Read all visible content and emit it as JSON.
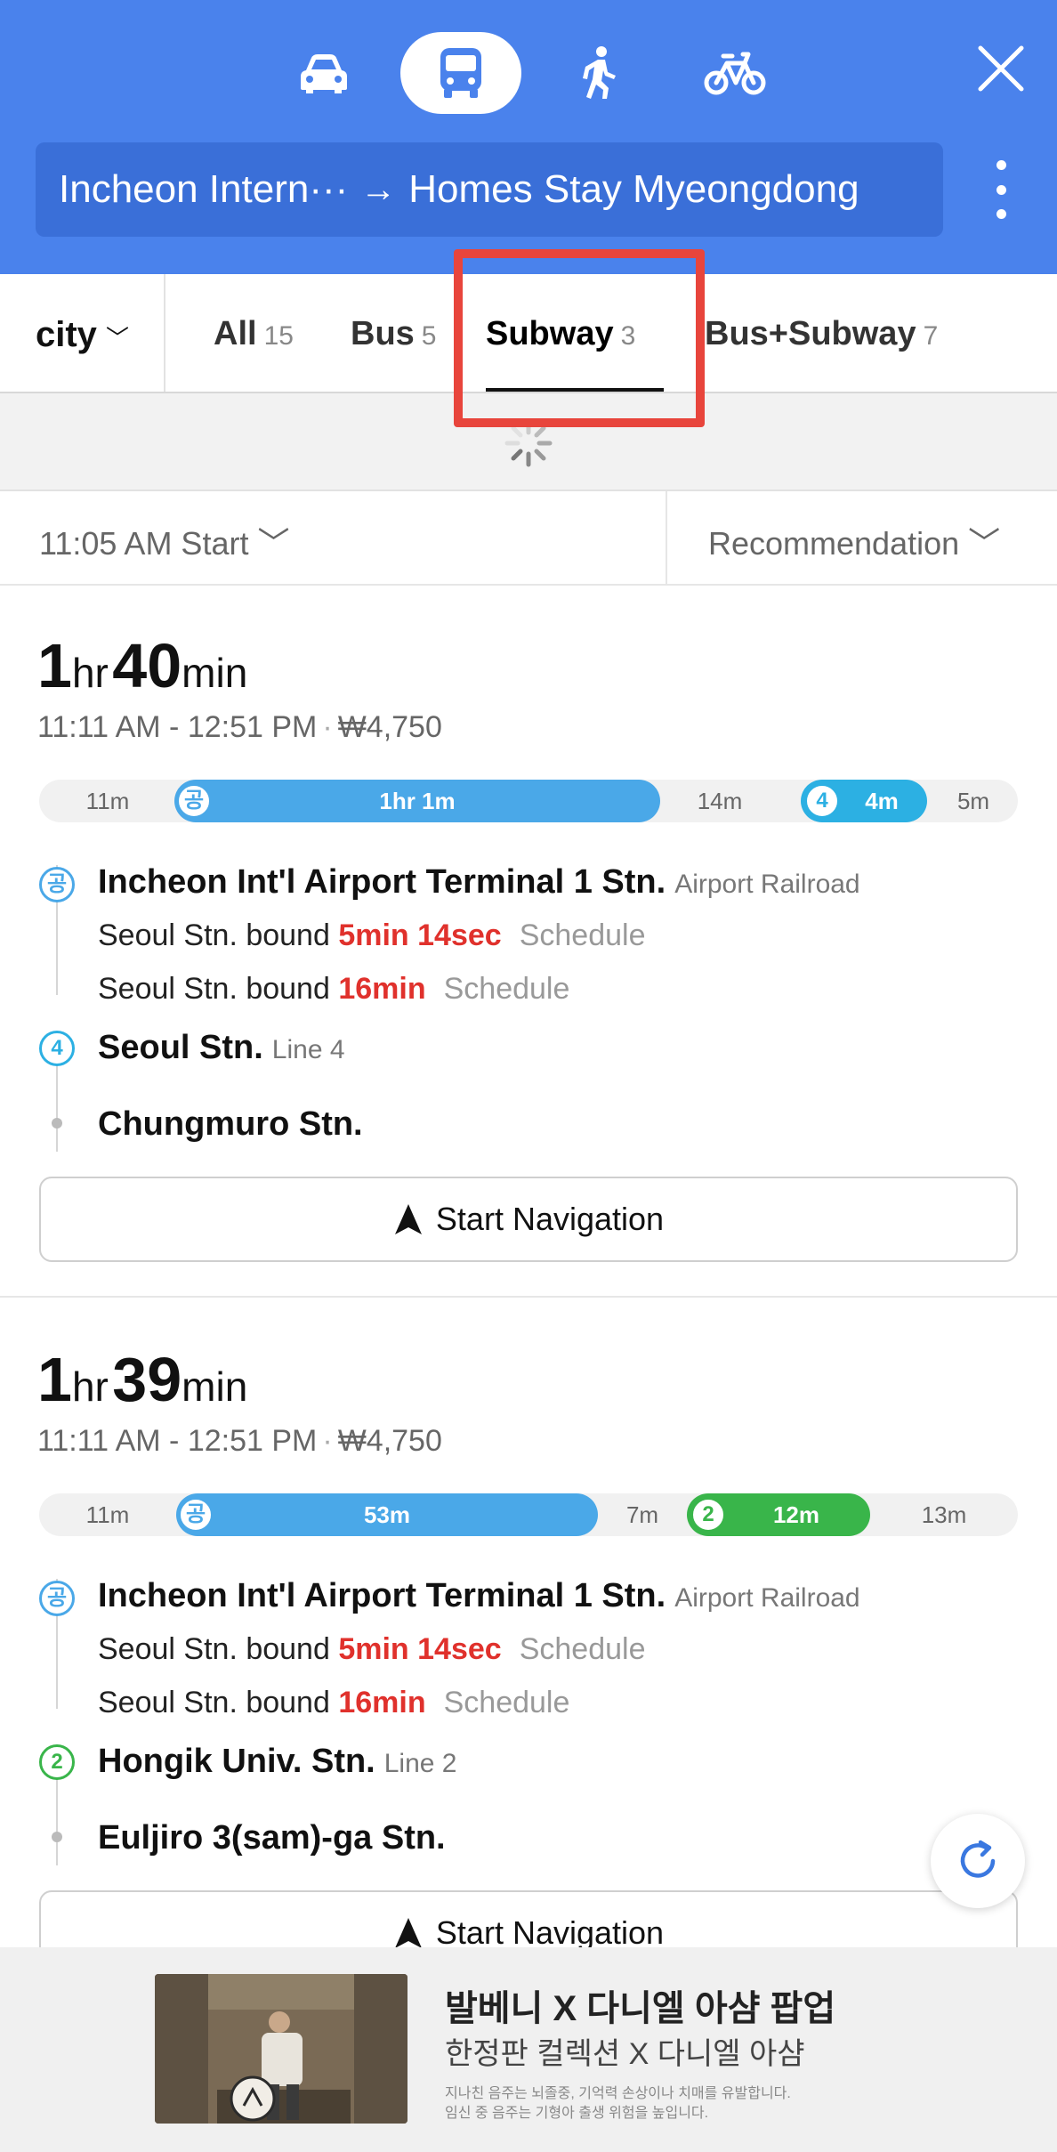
{
  "header": {
    "modes": [
      {
        "name": "car",
        "icon": "car-icon"
      },
      {
        "name": "transit",
        "icon": "bus-icon",
        "selected": true
      },
      {
        "name": "walk",
        "icon": "walk-icon"
      },
      {
        "name": "bike",
        "icon": "bike-icon"
      }
    ],
    "origin": "Incheon Intern···",
    "arrow": "→",
    "destination": "Homes Stay Myeongdong",
    "accent_color": "#4a82ec"
  },
  "tabs": {
    "region": "city",
    "items": [
      {
        "label": "All",
        "count": "15"
      },
      {
        "label": "Bus",
        "count": "5"
      },
      {
        "label": "Subway",
        "count": "3",
        "selected": true
      },
      {
        "label": "Bus+Subway",
        "count": "7"
      }
    ]
  },
  "options": {
    "start_time": "11:05 AM Start",
    "sort": "Recommendation"
  },
  "routes": [
    {
      "hours": "1",
      "hr_unit": "hr",
      "minutes": "40",
      "min_unit": "min",
      "time_range": "11:11 AM - 12:51 PM",
      "fare": "₩4,750",
      "timeline": [
        "11m",
        "1hr 1m",
        "14m",
        "4m",
        "5m"
      ],
      "stops": [
        {
          "badge": "공",
          "name": "Incheon Int'l Airport Terminal 1 Stn.",
          "line": "Airport Railroad"
        },
        {
          "badge": "4",
          "name": "Seoul Stn.",
          "line": "Line 4"
        },
        {
          "badge": "",
          "name": "Chungmuro Stn.",
          "line": ""
        }
      ],
      "arrivals": [
        {
          "bound": "Seoul Stn. bound",
          "time": "5min 14sec",
          "schedule": "Schedule"
        },
        {
          "bound": "Seoul Stn. bound",
          "time": "16min",
          "schedule": "Schedule"
        }
      ],
      "nav_label": "Start Navigation"
    },
    {
      "hours": "1",
      "hr_unit": "hr",
      "minutes": "39",
      "min_unit": "min",
      "time_range": "11:11 AM - 12:51 PM",
      "fare": "₩4,750",
      "timeline": [
        "11m",
        "53m",
        "7m",
        "12m",
        "13m"
      ],
      "stops": [
        {
          "badge": "공",
          "name": "Incheon Int'l Airport Terminal 1 Stn.",
          "line": "Airport Railroad"
        },
        {
          "badge": "2",
          "name": "Hongik Univ. Stn.",
          "line": "Line 2"
        },
        {
          "badge": "",
          "name": "Euljiro 3(sam)-ga Stn.",
          "line": ""
        }
      ],
      "arrivals": [
        {
          "bound": "Seoul Stn. bound",
          "time": "5min 14sec",
          "schedule": "Schedule"
        },
        {
          "bound": "Seoul Stn. bound",
          "time": "16min",
          "schedule": "Schedule"
        }
      ],
      "nav_label": "Start Navigation"
    }
  ],
  "line_colors": {
    "airport": "#4aa8e8",
    "line4": "#2cb0e3",
    "line2": "#39b54a",
    "realtime": "#e0312c"
  },
  "ad": {
    "title": "발베니 X 다니엘 아샴 팝업",
    "subtitle": "한정판 컬렉션 X 다니엘 아샴",
    "note1": "지나친 음주는 뇌졸중, 기억력 손상이나 치매를 유발합니다.",
    "note2": "임신 중 음주는 기형아 출생 위험을 높입니다."
  }
}
